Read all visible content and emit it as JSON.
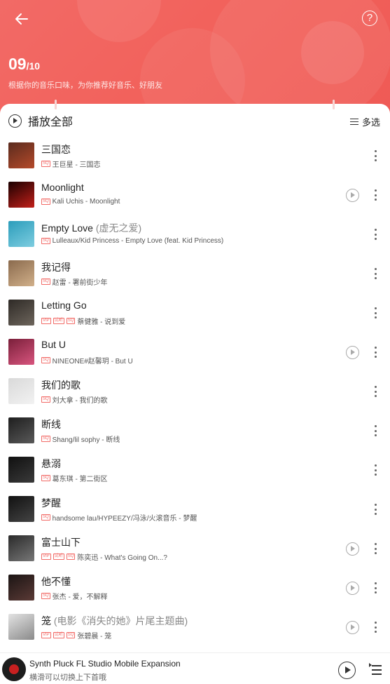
{
  "header": {
    "progress_current": "09",
    "progress_total": "/10",
    "subtitle": "根据你的音乐口味，为你推荐好音乐、好朋友",
    "accent": "#f2625c"
  },
  "toolbar": {
    "play_all_label": "播放全部",
    "multi_select_label": "多选"
  },
  "songs": [
    {
      "title": "三国恋",
      "subtitle": "",
      "tags": [
        "SQ"
      ],
      "meta": "王巨星 - 三国恋",
      "has_mv": false
    },
    {
      "title": "Moonlight",
      "subtitle": "",
      "tags": [
        "SQ"
      ],
      "meta": "Kali Uchis - Moonlight",
      "has_mv": true
    },
    {
      "title": "Empty Love",
      "subtitle": "(虚无之爱)",
      "tags": [
        "SQ"
      ],
      "meta": "Lulleaux/Kid Princess - Empty Love (feat. Kid Princess)",
      "has_mv": false
    },
    {
      "title": "我记得",
      "subtitle": "",
      "tags": [
        "SQ"
      ],
      "meta": "赵雷 - 署前街少年",
      "has_mv": false
    },
    {
      "title": "Letting Go",
      "subtitle": "",
      "tags": [
        "VIP",
        "试听",
        "SQ"
      ],
      "meta": "蔡健雅 - 说到爱",
      "has_mv": false
    },
    {
      "title": "But U",
      "subtitle": "",
      "tags": [
        "SQ"
      ],
      "meta": "NINEONE#赵馨玥 - But U",
      "has_mv": true
    },
    {
      "title": "我们的歌",
      "subtitle": "",
      "tags": [
        "SQ"
      ],
      "meta": "刘大拿 - 我们的歌",
      "has_mv": false
    },
    {
      "title": "断线",
      "subtitle": "",
      "tags": [
        "SQ"
      ],
      "meta": "Shang/lil sophy - 断线",
      "has_mv": false
    },
    {
      "title": "悬溺",
      "subtitle": "",
      "tags": [
        "SQ"
      ],
      "meta": "葛东琪 - 第二街区",
      "has_mv": false
    },
    {
      "title": "梦醒",
      "subtitle": "",
      "tags": [
        "SQ"
      ],
      "meta": "handsome lau/HYPEEZY/冯泳/火滚音乐 - 梦醒",
      "has_mv": false
    },
    {
      "title": "富士山下",
      "subtitle": "",
      "tags": [
        "VIP",
        "试听",
        "SQ"
      ],
      "meta": "陈奕迅 - What's Going On...?",
      "has_mv": true
    },
    {
      "title": "他不懂",
      "subtitle": "",
      "tags": [
        "SQ"
      ],
      "meta": "张杰 - 爱，不解释",
      "has_mv": true
    },
    {
      "title": "笼",
      "subtitle": "(电影《消失的她》片尾主题曲)",
      "tags": [
        "VIP",
        "试听",
        "SQ"
      ],
      "meta": "张碧晨 - 笼",
      "has_mv": true
    }
  ],
  "player": {
    "title": "Synth Pluck FL Studio Mobile Expansion",
    "hint": "横滑可以切换上下首哦"
  }
}
